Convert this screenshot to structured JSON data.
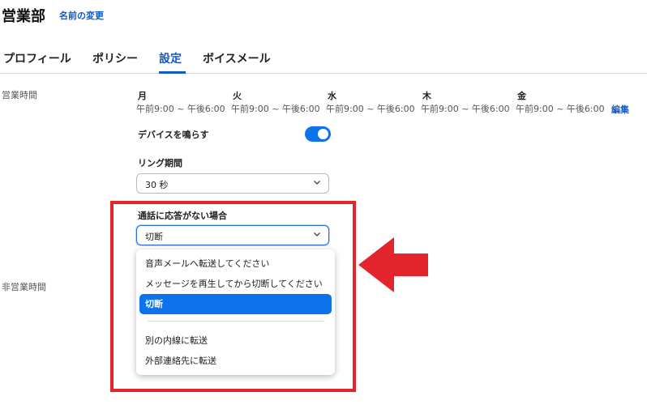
{
  "header": {
    "title": "営業部",
    "rename_link": "名前の変更"
  },
  "tabs": [
    {
      "label": "プロフィール",
      "active": false
    },
    {
      "label": "ポリシー",
      "active": false
    },
    {
      "label": "設定",
      "active": true
    },
    {
      "label": "ボイスメール",
      "active": false
    }
  ],
  "business_hours": {
    "label": "営業時間",
    "days": [
      {
        "name": "月",
        "hours": "午前9:00 ~ 午後6:00"
      },
      {
        "name": "火",
        "hours": "午前9:00 ~ 午後6:00"
      },
      {
        "name": "水",
        "hours": "午前9:00 ~ 午後6:00"
      },
      {
        "name": "木",
        "hours": "午前9:00 ~ 午後6:00"
      },
      {
        "name": "金",
        "hours": "午前9:00 ~ 午後6:00"
      }
    ],
    "edit_link": "編集",
    "ring_devices": {
      "label": "デバイスを鳴らす",
      "enabled": true
    },
    "ring_duration": {
      "label": "リング期間",
      "value": "30 秒"
    },
    "no_answer": {
      "label": "通話に応答がない場合",
      "value": "切断",
      "options": [
        "音声メールへ転送してください",
        "メッセージを再生してから切断してください",
        "切断",
        "別の内線に転送",
        "外部連絡先に転送"
      ],
      "selected_option": "切断"
    }
  },
  "after_hours": {
    "label": "非営業時間"
  },
  "colors": {
    "accent": "#0e72ed",
    "link": "#0e5ac9",
    "annotation": "#e3262d"
  }
}
